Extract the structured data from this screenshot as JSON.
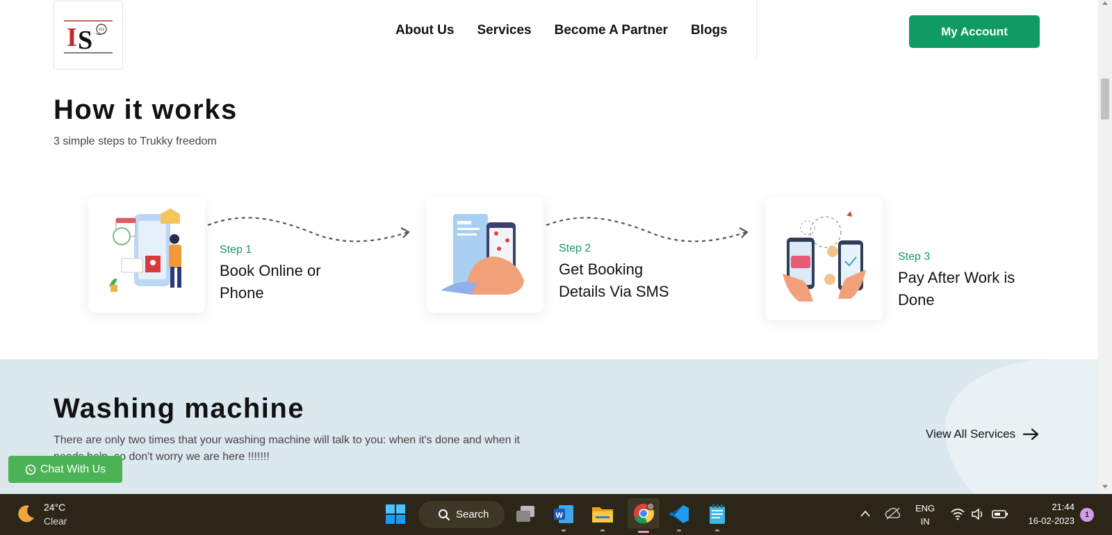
{
  "header": {
    "nav": [
      {
        "label": "About Us"
      },
      {
        "label": "Services"
      },
      {
        "label": "Become A Partner"
      },
      {
        "label": "Blogs"
      }
    ],
    "account_label": "My Account"
  },
  "how_it_works": {
    "title": "How it works",
    "subtitle": "3 simple steps to Trukky freedom",
    "steps": [
      {
        "label": "Step 1",
        "text": "Book Online or Phone"
      },
      {
        "label": "Step 2",
        "text": "Get Booking Details Via SMS"
      },
      {
        "label": "Step 3",
        "text": "Pay After Work is Done"
      }
    ]
  },
  "service": {
    "title": "Washing machine",
    "description": "There are only two times that your washing machine will talk to you: when it's done and when it needs help, so don't worry we are here !!!!!!!",
    "view_all_label": "View All Services"
  },
  "chat": {
    "label": "Chat With Us"
  },
  "taskbar": {
    "weather_temp": "24°C",
    "weather_condition": "Clear",
    "search_label": "Search",
    "lang_line1": "ENG",
    "lang_line2": "IN",
    "time": "21:44",
    "date": "16-02-2023",
    "notification_count": "1"
  },
  "colors": {
    "brand_green": "#0f9b63",
    "chat_green": "#4bb356",
    "band_bg": "#dbe8ee",
    "taskbar_bg": "#2b2618"
  }
}
